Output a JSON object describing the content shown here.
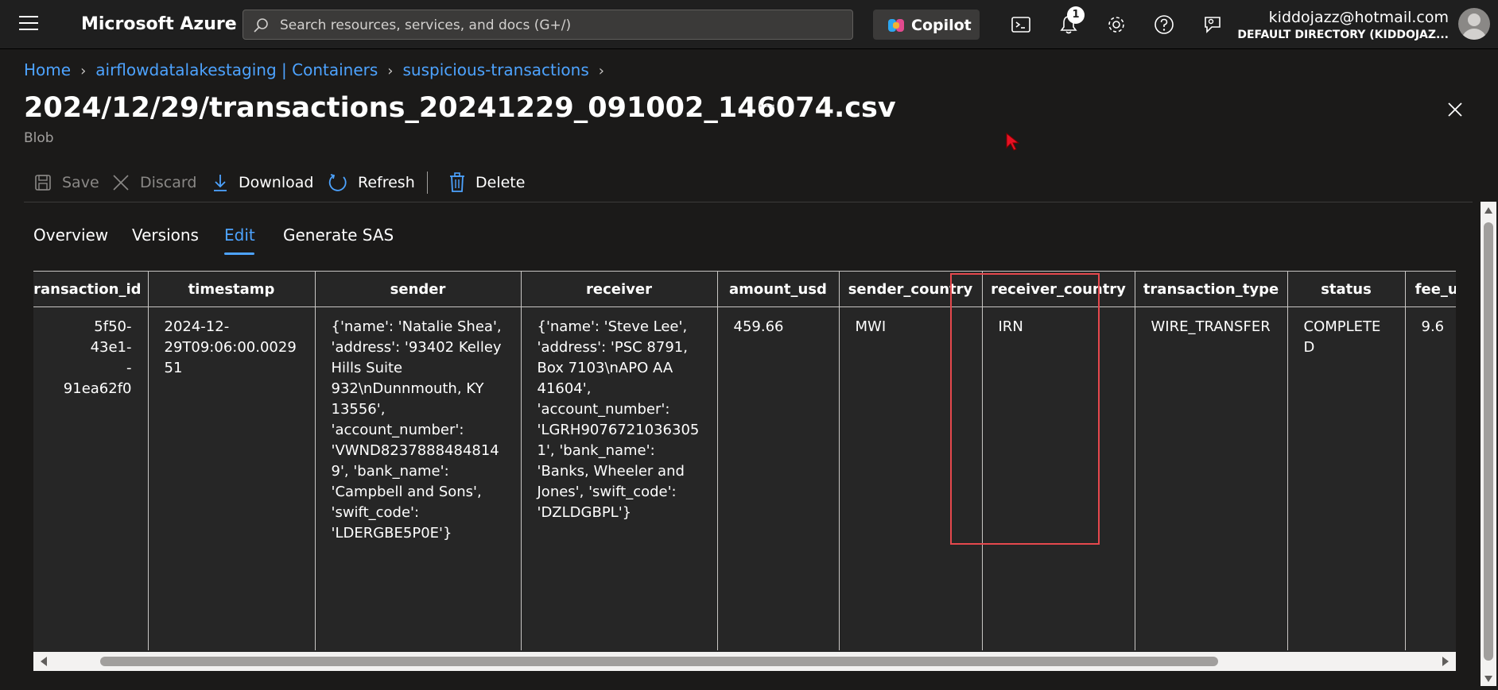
{
  "topbar": {
    "brand": "Microsoft Azure",
    "search_placeholder": "Search resources, services, and docs (G+/)",
    "copilot_label": "Copilot",
    "notification_count": "1",
    "account_email": "kiddojazz@hotmail.com",
    "account_directory": "DEFAULT DIRECTORY (KIDDOJAZ..."
  },
  "breadcrumb": {
    "items": [
      "Home",
      "airflowdatalakestaging | Containers",
      "suspicious-transactions"
    ]
  },
  "page": {
    "title": "2024/12/29/transactions_20241229_091002_146074.csv",
    "subtitle": "Blob",
    "more": "···"
  },
  "commands": {
    "save": "Save",
    "discard": "Discard",
    "download": "Download",
    "refresh": "Refresh",
    "delete": "Delete"
  },
  "tabs": [
    "Overview",
    "Versions",
    "Edit",
    "Generate SAS"
  ],
  "active_tab": "Edit",
  "grid": {
    "headers": [
      "transaction_id",
      "timestamp",
      "sender",
      "receiver",
      "amount_usd",
      "sender_country",
      "receiver_country",
      "transaction_type",
      "status",
      "fee_usd"
    ],
    "row": [
      "5f50-\n43e1-\n-\n91ea62f0",
      "2024-12-29T09:06:00.002951",
      "{'name': 'Natalie Shea', 'address': '93402 Kelley Hills Suite 932\\nDunnmouth, KY 13556', 'account_number': 'VWND82378884848149', 'bank_name': 'Campbell and Sons', 'swift_code': 'LDERGBE5P0E'}",
      "{'name': 'Steve Lee', 'address': 'PSC 8791, Box 7103\\nAPO AA 41604', 'account_number': 'LGRH90767210363051', 'bank_name': 'Banks, Wheeler and Jones', 'swift_code': 'DZLDGBPL'}",
      "459.66",
      "MWI",
      "IRN",
      "WIRE_TRANSFER",
      "COMPLETED",
      "9.6"
    ]
  },
  "colors": {
    "background": "#1b1a19",
    "link": "#4da3ff",
    "highlight": "#e5484d",
    "cursor": "#e81123"
  }
}
